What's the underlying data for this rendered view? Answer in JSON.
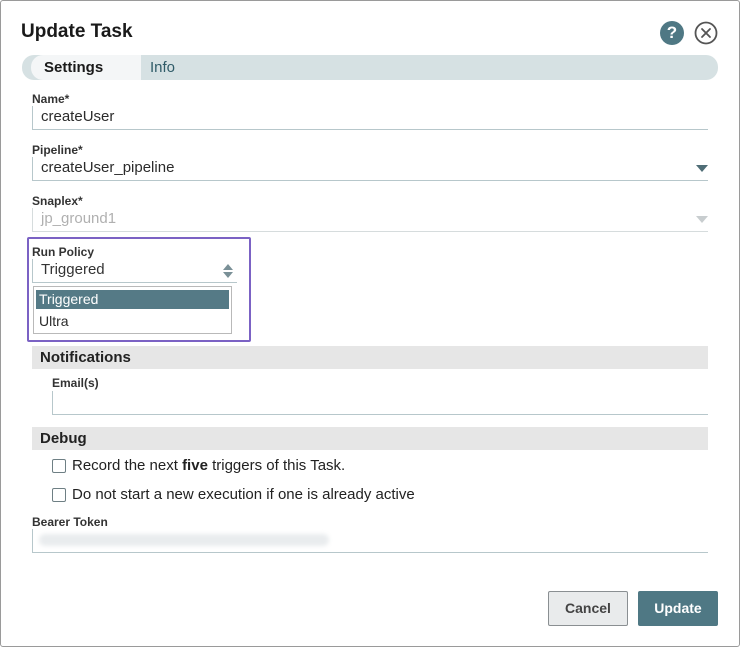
{
  "dialog": {
    "title": "Update Task"
  },
  "icons": {
    "help": "?"
  },
  "tabs": [
    {
      "label": "Settings",
      "active": true
    },
    {
      "label": "Info",
      "active": false
    }
  ],
  "form": {
    "name": {
      "label": "Name*",
      "value": "createUser"
    },
    "pipeline": {
      "label": "Pipeline*",
      "value": "createUser_pipeline"
    },
    "snaplex": {
      "label": "Snaplex*",
      "value": "jp_ground1"
    },
    "run_policy": {
      "label": "Run Policy",
      "value": "Triggered",
      "options": [
        {
          "label": "Triggered",
          "selected": true
        },
        {
          "label": "Ultra",
          "selected": false
        }
      ]
    }
  },
  "notifications": {
    "heading": "Notifications",
    "email_label": "Email(s)",
    "email_value": ""
  },
  "debug": {
    "heading": "Debug",
    "record_prefix": "Record the next ",
    "record_bold": "five",
    "record_suffix": " triggers of this Task.",
    "record_checked": false,
    "no_start_label": "Do not start a new execution if one is already active",
    "no_start_checked": false
  },
  "bearer": {
    "label": "Bearer Token"
  },
  "buttons": {
    "cancel": "Cancel",
    "update": "Update"
  },
  "colors": {
    "accent": "#4f7884",
    "highlight": "#7b62c4",
    "selected_option": "#557a86"
  }
}
